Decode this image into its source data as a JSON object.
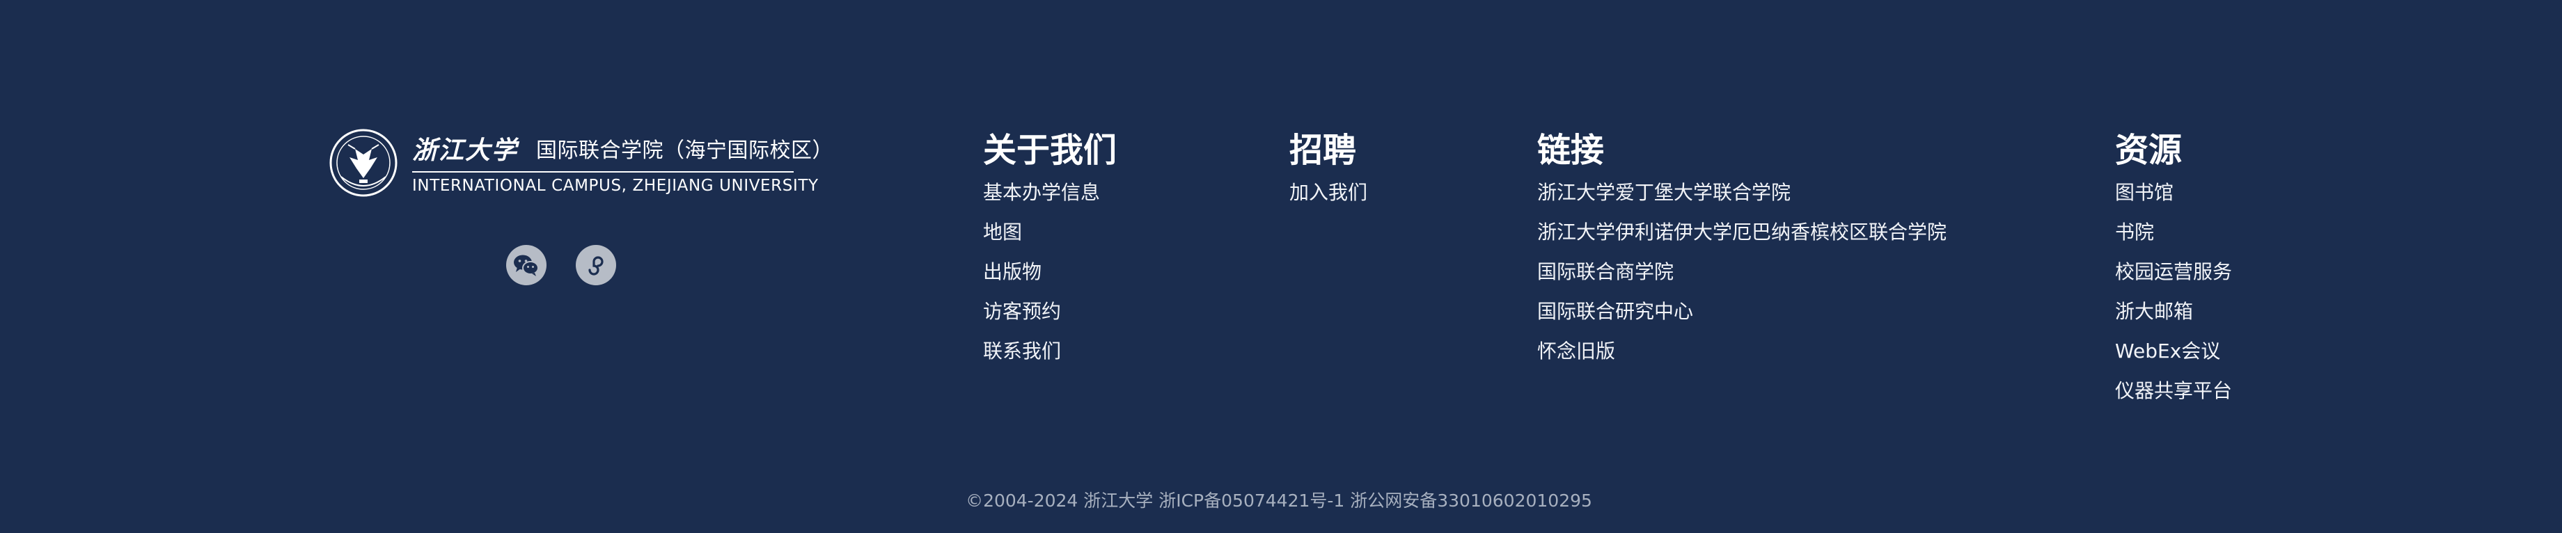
{
  "logo": {
    "calligraphy_name": "浙江大学",
    "campus_cn": "国际联合学院（海宁国际校区）",
    "campus_en": "INTERNATIONAL CAMPUS, ZHEJIANG UNIVERSITY"
  },
  "social": [
    {
      "icon": "wechat-icon"
    },
    {
      "icon": "mini-program-icon"
    }
  ],
  "columns": [
    {
      "title": "关于我们",
      "items": [
        "基本办学信息",
        "地图",
        "出版物",
        "访客预约",
        "联系我们"
      ]
    },
    {
      "title": "招聘",
      "items": [
        "加入我们"
      ]
    },
    {
      "title": "链接",
      "items": [
        "浙江大学爱丁堡大学联合学院",
        "浙江大学伊利诺伊大学厄巴纳香槟校区联合学院",
        "国际联合商学院",
        "国际联合研究中心",
        "怀念旧版"
      ]
    },
    {
      "title": "资源",
      "items": [
        "图书馆",
        "书院",
        "校园运营服务",
        "浙大邮箱",
        "WebEx会议",
        "仪器共享平台"
      ]
    }
  ],
  "copyright": "©2004-2024 浙江大学 浙ICP备05074421号-1 浙公网安备33010602010295",
  "colors": {
    "background": "#1b2d4f",
    "text": "#ffffff",
    "icon_circle": "#b6bcc6",
    "copyright": "#a7b0bf"
  }
}
